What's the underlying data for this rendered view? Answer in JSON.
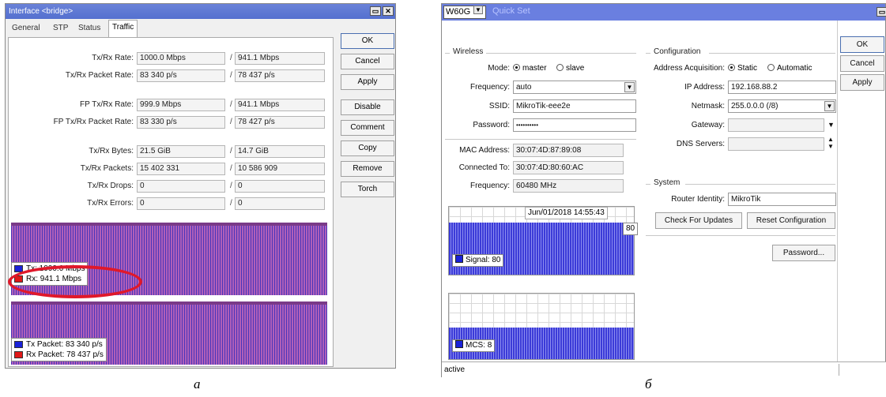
{
  "left_window": {
    "title": "Interface <bridge>",
    "tabs": [
      "General",
      "STP",
      "Status",
      "Traffic"
    ],
    "active_tab": "Traffic",
    "rows": [
      {
        "label": "Tx/Rx Rate:",
        "tx": "1000.0 Mbps",
        "rx": "941.1 Mbps"
      },
      {
        "label": "Tx/Rx Packet Rate:",
        "tx": "83 340 p/s",
        "rx": "78 437 p/s"
      },
      {
        "label": "FP Tx/Rx Rate:",
        "tx": "999.9 Mbps",
        "rx": "941.1 Mbps"
      },
      {
        "label": "FP Tx/Rx Packet Rate:",
        "tx": "83 330 p/s",
        "rx": "78 427 p/s"
      },
      {
        "label": "Tx/Rx Bytes:",
        "tx": "21.5 GiB",
        "rx": "14.7 GiB"
      },
      {
        "label": "Tx/Rx Packets:",
        "tx": "15 402 331",
        "rx": "10 586 909"
      },
      {
        "label": "Tx/Rx Drops:",
        "tx": "0",
        "rx": "0"
      },
      {
        "label": "Tx/Rx Errors:",
        "tx": "0",
        "rx": "0"
      }
    ],
    "slash": "/",
    "buttons": [
      "OK",
      "Cancel",
      "Apply",
      "Disable",
      "Comment",
      "Copy",
      "Remove",
      "Torch"
    ],
    "rate_legend": {
      "tx": "Tx:  1000.0 Mbps",
      "rx": "Rx:  941.1 Mbps"
    },
    "packet_legend": {
      "tx": "Tx Packet:  83 340 p/s",
      "rx": "Rx Packet:  78 437 p/s"
    },
    "colors": {
      "tx": "#1a22d8",
      "rx": "#e01818",
      "highlight": "#e0182a",
      "graph": "#a055ae"
    }
  },
  "right_window": {
    "interface": "W60G",
    "title": "Quick Set",
    "wireless": {
      "section": "Wireless",
      "mode_label": "Mode:",
      "mode_options": [
        "master",
        "slave"
      ],
      "mode_selected": "master",
      "frequency_label": "Frequency:",
      "frequency_value": "auto",
      "ssid_label": "SSID:",
      "ssid_value": "MikroTik-eee2e",
      "password_label": "Password:",
      "password_value": "••••••••••",
      "mac_label": "MAC Address:",
      "mac_value": "30:07:4D:87:89:08",
      "connected_label": "Connected To:",
      "connected_value": "30:07:4D:80:60:AC",
      "frequency2_label": "Frequency:",
      "frequency2_value": "60480 MHz"
    },
    "configuration": {
      "section": "Configuration",
      "acq_label": "Address Acquisition:",
      "acq_options": [
        "Static",
        "Automatic"
      ],
      "acq_selected": "Static",
      "ip_label": "IP Address:",
      "ip_value": "192.168.88.2",
      "netmask_label": "Netmask:",
      "netmask_value": "255.0.0.0 (/8)",
      "gateway_label": "Gateway:",
      "gateway_value": "",
      "dns_label": "DNS Servers:",
      "dns_value": ""
    },
    "system": {
      "section": "System",
      "identity_label": "Router Identity:",
      "identity_value": "MikroTik",
      "check_updates": "Check For Updates",
      "reset_config": "Reset Configuration",
      "password_button": "Password..."
    },
    "signal_graph": {
      "timestamp": "Jun/01/2018 14:55:43",
      "value_tag": "80",
      "legend": "Signal:  80",
      "level": 80
    },
    "mcs_graph": {
      "legend": "MCS:  8",
      "level": 8
    },
    "buttons": [
      "OK",
      "Cancel",
      "Apply"
    ],
    "status": "active"
  },
  "captions": {
    "a": "a",
    "b": "б"
  }
}
